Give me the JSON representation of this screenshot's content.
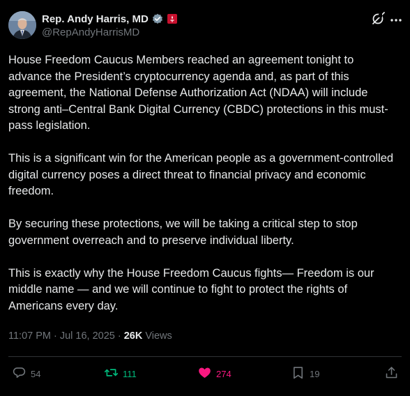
{
  "author": {
    "display_name": "Rep. Andy Harris, MD",
    "handle": "@RepAndyHarrisMD",
    "verified_color": "#829aab",
    "affiliation_color": "#c8102e"
  },
  "tweet": {
    "paragraphs": [
      "House Freedom Caucus Members reached an agreement tonight to advance the President’s cryptocurrency agenda and, as part of this agreement, the National Defense Authorization Act (NDAA) will include strong anti–Central Bank Digital Currency (CBDC) protections in this must-pass legislation.",
      "This is a significant win for the American people as a government-controlled digital currency poses a direct threat to financial privacy and economic freedom.",
      "By securing these protections, we will be taking a critical step to stop government overreach and to preserve individual liberty.",
      "This is exactly why the House Freedom Caucus fights— Freedom is our middle name — and we will continue to fight to protect the rights of Americans every day."
    ],
    "time": "11:07 PM",
    "date": "Jul 16, 2025",
    "separator": "·",
    "views_count": "26K",
    "views_label": "Views"
  },
  "actions": {
    "replies": "54",
    "reposts": "111",
    "likes": "274",
    "bookmarks": "19"
  },
  "colors": {
    "background": "#000000",
    "text": "#e7e9ea",
    "muted": "#71767b",
    "repost": "#00ba7c",
    "like": "#f91880"
  },
  "icons": [
    "grok-icon",
    "more-icon",
    "reply-icon",
    "repost-icon",
    "like-icon",
    "bookmark-icon",
    "share-icon"
  ]
}
